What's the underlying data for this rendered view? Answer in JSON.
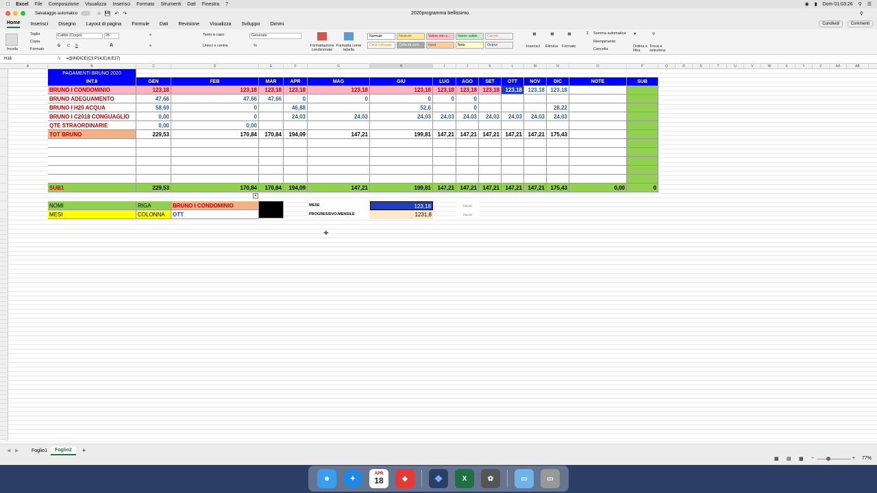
{
  "menubar": {
    "app": "Excel",
    "items": [
      "File",
      "Composizione",
      "Visualizza",
      "Inserisci",
      "Formato",
      "Strumenti",
      "Dati",
      "Finestra",
      "?"
    ],
    "clock": "Dom 01:03:26"
  },
  "window": {
    "autosave": "Salvataggio automatico",
    "title": "2020programma bellissimo."
  },
  "ribbon_tabs": [
    "Home",
    "Inserisci",
    "Disegno",
    "Layout di pagina",
    "Formule",
    "Dati",
    "Revisione",
    "Visualizza",
    "Sviluppo",
    "Dimmi"
  ],
  "share": {
    "share_label": "Condividi",
    "comments_label": "Commenti"
  },
  "ribbon": {
    "paste": "Incolla",
    "cut": "Taglia",
    "copy": "Copia",
    "format": "Formato",
    "font": "Calibri (Corpo)",
    "size": "26",
    "wrap": "Testo a capo",
    "merge": "Unisci e centra",
    "numfmt": "Generale",
    "cond": "Formattazione condizionale",
    "astable": "Formatta come tabella",
    "styles": [
      {
        "label": "Normale",
        "bg": "#ffffff",
        "fg": "#000000"
      },
      {
        "label": "Neutrale",
        "bg": "#ffeb9c",
        "fg": "#9c5700"
      },
      {
        "label": "Valore non v...",
        "bg": "#ffc7ce",
        "fg": "#9c0006"
      },
      {
        "label": "Valore valido",
        "bg": "#c6efce",
        "fg": "#006100"
      },
      {
        "label": "Calcolo",
        "bg": "#f2f2f2",
        "fg": "#fa7d00"
      },
      {
        "label": "Cella collegata",
        "bg": "#ffffff",
        "fg": "#fa7d00"
      },
      {
        "label": "Cella da cont...",
        "bg": "#a5a5a5",
        "fg": "#ffffff"
      },
      {
        "label": "Input",
        "bg": "#ffcc99",
        "fg": "#3f3f76"
      },
      {
        "label": "Nota",
        "bg": "#ffffcc",
        "fg": "#000000"
      },
      {
        "label": "Output",
        "bg": "#f2f2f2",
        "fg": "#3f3f3f"
      }
    ],
    "insert": "Inserisci",
    "delete": "Elimina",
    "formatcells": "Formato",
    "autosum": "Somma automatica",
    "fill": "Riempimento",
    "clear": "Cancella",
    "sort": "Ordina e filtra",
    "find": "Trova e seleziona"
  },
  "formula": {
    "cell": "H16",
    "fx": "fx",
    "content": "=@INDICE(C3:P14;E16;E17)"
  },
  "columns": [
    "A",
    "B",
    "C",
    "D",
    "E",
    "F",
    "G",
    "H",
    "I",
    "J",
    "K",
    "L",
    "M",
    "N",
    "O",
    "P",
    "Q",
    "R",
    "S",
    "T",
    "U",
    "V",
    "W",
    "X",
    "Y",
    "Z",
    "AA",
    "AB"
  ],
  "table": {
    "title": "PAGAMENTI BRUNO 2020",
    "header": [
      "INT.8",
      "GEN",
      "FEB",
      "MAR",
      "APR",
      "MAG",
      "GIU",
      "LUG",
      "AGO",
      "SET",
      "OTT",
      "NOV",
      "DIC",
      "NOTE",
      "SUB"
    ],
    "rows": [
      {
        "label": "BRUNO I CONDOMINIO",
        "vals": [
          "123,18",
          "123,18",
          "123,18",
          "123,18",
          "123,18",
          "123,18",
          "123,18",
          "123,18",
          "123,18",
          "123,18",
          "123,18",
          "123,18",
          "",
          ""
        ]
      },
      {
        "label": "BRUNO  ADEGUAMENTO",
        "vals": [
          "47,66",
          "47,66",
          "47,66",
          "0",
          "0",
          "0",
          "0",
          "0",
          "",
          "",
          "",
          "",
          "",
          ""
        ]
      },
      {
        "label": "BRUNO I H20 ACQUA",
        "vals": [
          "58,69",
          "0",
          "",
          "46,88",
          "",
          "52,6",
          "",
          "0",
          "",
          "",
          "",
          "28,22",
          "",
          ""
        ]
      },
      {
        "label": "BRUNO I C2018 CONGUAGLIO",
        "vals": [
          "0,00",
          "0",
          "",
          "24,03",
          "24,03",
          "24,03",
          "24,03",
          "24,03",
          "24,03",
          "24,03",
          "24,03",
          "24,03",
          "",
          ""
        ]
      },
      {
        "label": "QTE STRAORDINARIE",
        "vals": [
          "0,00",
          "0,00",
          "",
          "",
          "",
          "",
          "",
          "",
          "",
          "",
          "",
          "",
          "",
          ""
        ]
      },
      {
        "label": "TOT BRUNO",
        "vals": [
          "229,53",
          "170,84",
          "170,84",
          "194,09",
          "147,21",
          "199,81",
          "147,21",
          "147,21",
          "147,21",
          "147,21",
          "147,21",
          "175,43",
          "",
          ""
        ]
      }
    ],
    "sub": {
      "label": "SUB1",
      "vals": [
        "229,53",
        "170,84",
        "170,84",
        "194,09",
        "147,21",
        "199,81",
        "147,21",
        "147,21",
        "147,21",
        "147,21",
        "147,21",
        "175,43",
        "0,00",
        "0"
      ]
    }
  },
  "lookup": {
    "nomi": "NOMI",
    "riga": "RIGA",
    "nomi_val": "BRUNO I CONDOMINIO",
    "mesi": "MESI",
    "colonna": "COLONNA",
    "mesi_val": "OTT",
    "mese": "MESE",
    "mese_val": "123,18",
    "prog": "PROGRESSIVO.MENSILE",
    "prog_val": "1231,8",
    "falso1": "FALSO",
    "falso2": "FALSO"
  },
  "sheets": {
    "tabs": [
      "Foglio1",
      "Foglio2"
    ],
    "active": "Foglio2",
    "add": "+",
    "zoom": "77%"
  },
  "dock": {
    "icons": [
      "finder-icon",
      "safari-icon",
      "calendar-icon",
      "anydesk-icon",
      "dropbox-icon",
      "excel-icon",
      "photos-icon",
      "folder-icon",
      "trash-icon"
    ],
    "calendar_month": "APR",
    "calendar_day": "18"
  },
  "colors": {
    "blue_header": "#0000ff",
    "red_text": "#c00000",
    "pink": "#f8b4c0",
    "green": "#92d050",
    "yellow": "#ffff00",
    "orange": "#f4b183",
    "salmon": "#f4b183"
  }
}
